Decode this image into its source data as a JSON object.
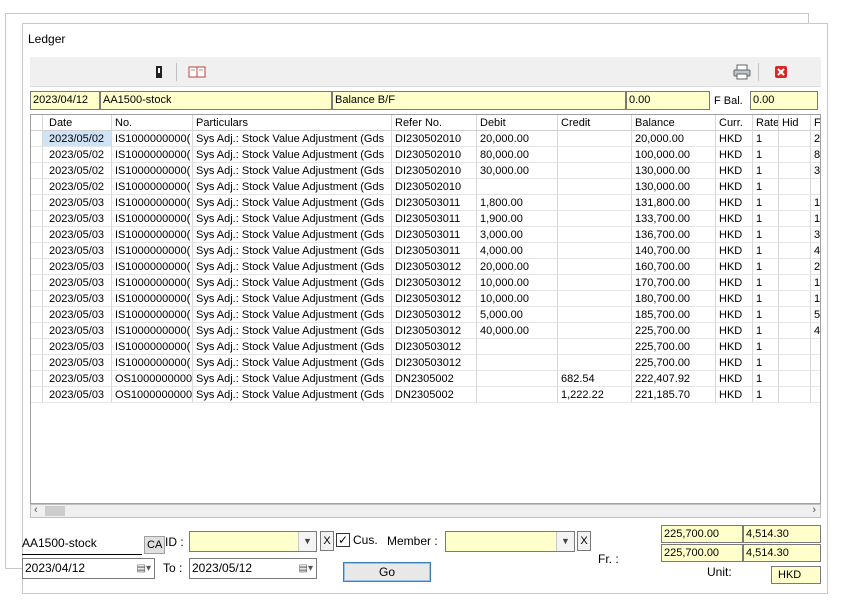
{
  "window": {
    "title": "Ledger"
  },
  "toolbar": {
    "left_icons": [
      "bookmark-icon",
      "book-icon"
    ],
    "right_icons": [
      "printer-icon",
      "close-icon"
    ]
  },
  "header": {
    "date": "2023/04/12",
    "account": "AA1500-stock",
    "description": "Balance B/F",
    "balance": "0.00",
    "f_bal_label": "F Bal.",
    "f_bal": "0.00"
  },
  "grid": {
    "columns": [
      "Date",
      "No.",
      "Particulars",
      "Refer No.",
      "Debit",
      "Credit",
      "Balance",
      "Curr.",
      "Rate",
      "Hid",
      "F"
    ],
    "rows": [
      {
        "date": "2023/05/02",
        "no": "IS1000000000(",
        "part": "Sys Adj.: Stock Value Adjustment (Gds",
        "ref": "DI230502010",
        "debit": "20,000.00",
        "credit": "",
        "bal": "20,000.00",
        "curr": "HKD",
        "rate": "1",
        "hid": "",
        "f": "2"
      },
      {
        "date": "2023/05/02",
        "no": "IS1000000000(",
        "part": "Sys Adj.: Stock Value Adjustment (Gds",
        "ref": "DI230502010",
        "debit": "80,000.00",
        "credit": "",
        "bal": "100,000.00",
        "curr": "HKD",
        "rate": "1",
        "hid": "",
        "f": "8"
      },
      {
        "date": "2023/05/02",
        "no": "IS1000000000(",
        "part": "Sys Adj.: Stock Value Adjustment (Gds",
        "ref": "DI230502010",
        "debit": "30,000.00",
        "credit": "",
        "bal": "130,000.00",
        "curr": "HKD",
        "rate": "1",
        "hid": "",
        "f": "3"
      },
      {
        "date": "2023/05/02",
        "no": "IS1000000000(",
        "part": "Sys Adj.: Stock Value Adjustment (Gds",
        "ref": "DI230502010",
        "debit": "",
        "credit": "",
        "bal": "130,000.00",
        "curr": "HKD",
        "rate": "1",
        "hid": "",
        "f": ""
      },
      {
        "date": "2023/05/03",
        "no": "IS1000000000(",
        "part": "Sys Adj.: Stock Value Adjustment (Gds",
        "ref": "DI230503011",
        "debit": "1,800.00",
        "credit": "",
        "bal": "131,800.00",
        "curr": "HKD",
        "rate": "1",
        "hid": "",
        "f": "1"
      },
      {
        "date": "2023/05/03",
        "no": "IS1000000000(",
        "part": "Sys Adj.: Stock Value Adjustment (Gds",
        "ref": "DI230503011",
        "debit": "1,900.00",
        "credit": "",
        "bal": "133,700.00",
        "curr": "HKD",
        "rate": "1",
        "hid": "",
        "f": "1"
      },
      {
        "date": "2023/05/03",
        "no": "IS1000000000(",
        "part": "Sys Adj.: Stock Value Adjustment (Gds",
        "ref": "DI230503011",
        "debit": "3,000.00",
        "credit": "",
        "bal": "136,700.00",
        "curr": "HKD",
        "rate": "1",
        "hid": "",
        "f": "3"
      },
      {
        "date": "2023/05/03",
        "no": "IS1000000000(",
        "part": "Sys Adj.: Stock Value Adjustment (Gds",
        "ref": "DI230503011",
        "debit": "4,000.00",
        "credit": "",
        "bal": "140,700.00",
        "curr": "HKD",
        "rate": "1",
        "hid": "",
        "f": "4"
      },
      {
        "date": "2023/05/03",
        "no": "IS1000000000(",
        "part": "Sys Adj.: Stock Value Adjustment (Gds",
        "ref": "DI230503012",
        "debit": "20,000.00",
        "credit": "",
        "bal": "160,700.00",
        "curr": "HKD",
        "rate": "1",
        "hid": "",
        "f": "2"
      },
      {
        "date": "2023/05/03",
        "no": "IS1000000000(",
        "part": "Sys Adj.: Stock Value Adjustment (Gds",
        "ref": "DI230503012",
        "debit": "10,000.00",
        "credit": "",
        "bal": "170,700.00",
        "curr": "HKD",
        "rate": "1",
        "hid": "",
        "f": "1"
      },
      {
        "date": "2023/05/03",
        "no": "IS1000000000(",
        "part": "Sys Adj.: Stock Value Adjustment (Gds",
        "ref": "DI230503012",
        "debit": "10,000.00",
        "credit": "",
        "bal": "180,700.00",
        "curr": "HKD",
        "rate": "1",
        "hid": "",
        "f": "1"
      },
      {
        "date": "2023/05/03",
        "no": "IS1000000000(",
        "part": "Sys Adj.: Stock Value Adjustment (Gds",
        "ref": "DI230503012",
        "debit": "5,000.00",
        "credit": "",
        "bal": "185,700.00",
        "curr": "HKD",
        "rate": "1",
        "hid": "",
        "f": "5"
      },
      {
        "date": "2023/05/03",
        "no": "IS1000000000(",
        "part": "Sys Adj.: Stock Value Adjustment (Gds",
        "ref": "DI230503012",
        "debit": "40,000.00",
        "credit": "",
        "bal": "225,700.00",
        "curr": "HKD",
        "rate": "1",
        "hid": "",
        "f": "4"
      },
      {
        "date": "2023/05/03",
        "no": "IS1000000000(",
        "part": "Sys Adj.: Stock Value Adjustment (Gds",
        "ref": "DI230503012",
        "debit": "",
        "credit": "",
        "bal": "225,700.00",
        "curr": "HKD",
        "rate": "1",
        "hid": "",
        "f": ""
      },
      {
        "date": "2023/05/03",
        "no": "IS1000000000(",
        "part": "Sys Adj.: Stock Value Adjustment (Gds",
        "ref": "DI230503012",
        "debit": "",
        "credit": "",
        "bal": "225,700.00",
        "curr": "HKD",
        "rate": "1",
        "hid": "",
        "f": ""
      },
      {
        "date": "2023/05/03",
        "no": "OS1000000000(",
        "part": "Sys Adj.: Stock Value Adjustment (Gds",
        "ref": "DN2305002",
        "debit": "",
        "credit": "682.54",
        "bal": "222,407.92",
        "curr": "HKD",
        "rate": "1",
        "hid": "",
        "f": ""
      },
      {
        "date": "2023/05/03",
        "no": "OS1000000000(",
        "part": "Sys Adj.: Stock Value Adjustment (Gds",
        "ref": "DN2305002",
        "debit": "",
        "credit": "1,222.22",
        "bal": "221,185.70",
        "curr": "HKD",
        "rate": "1",
        "hid": "",
        "f": ""
      }
    ]
  },
  "filter": {
    "account": "AA1500-stock",
    "ca_label": "CA",
    "id_label": "ID :",
    "id_value": "",
    "x_label": "X",
    "cus_label": "Cus.",
    "cus_checked": true,
    "member_label": "Member :",
    "member_value": "",
    "from_date": "2023/04/12",
    "to_label": "To :",
    "to_date": "2023/05/12",
    "go_label": "Go",
    "fr_label": "Fr. :",
    "unit_label": "Unit:",
    "unit_value": "HKD"
  },
  "totals": {
    "row1_a": "225,700.00",
    "row1_b": "4,514.30",
    "row2_a": "225,700.00",
    "row2_b": "4,514.30"
  }
}
